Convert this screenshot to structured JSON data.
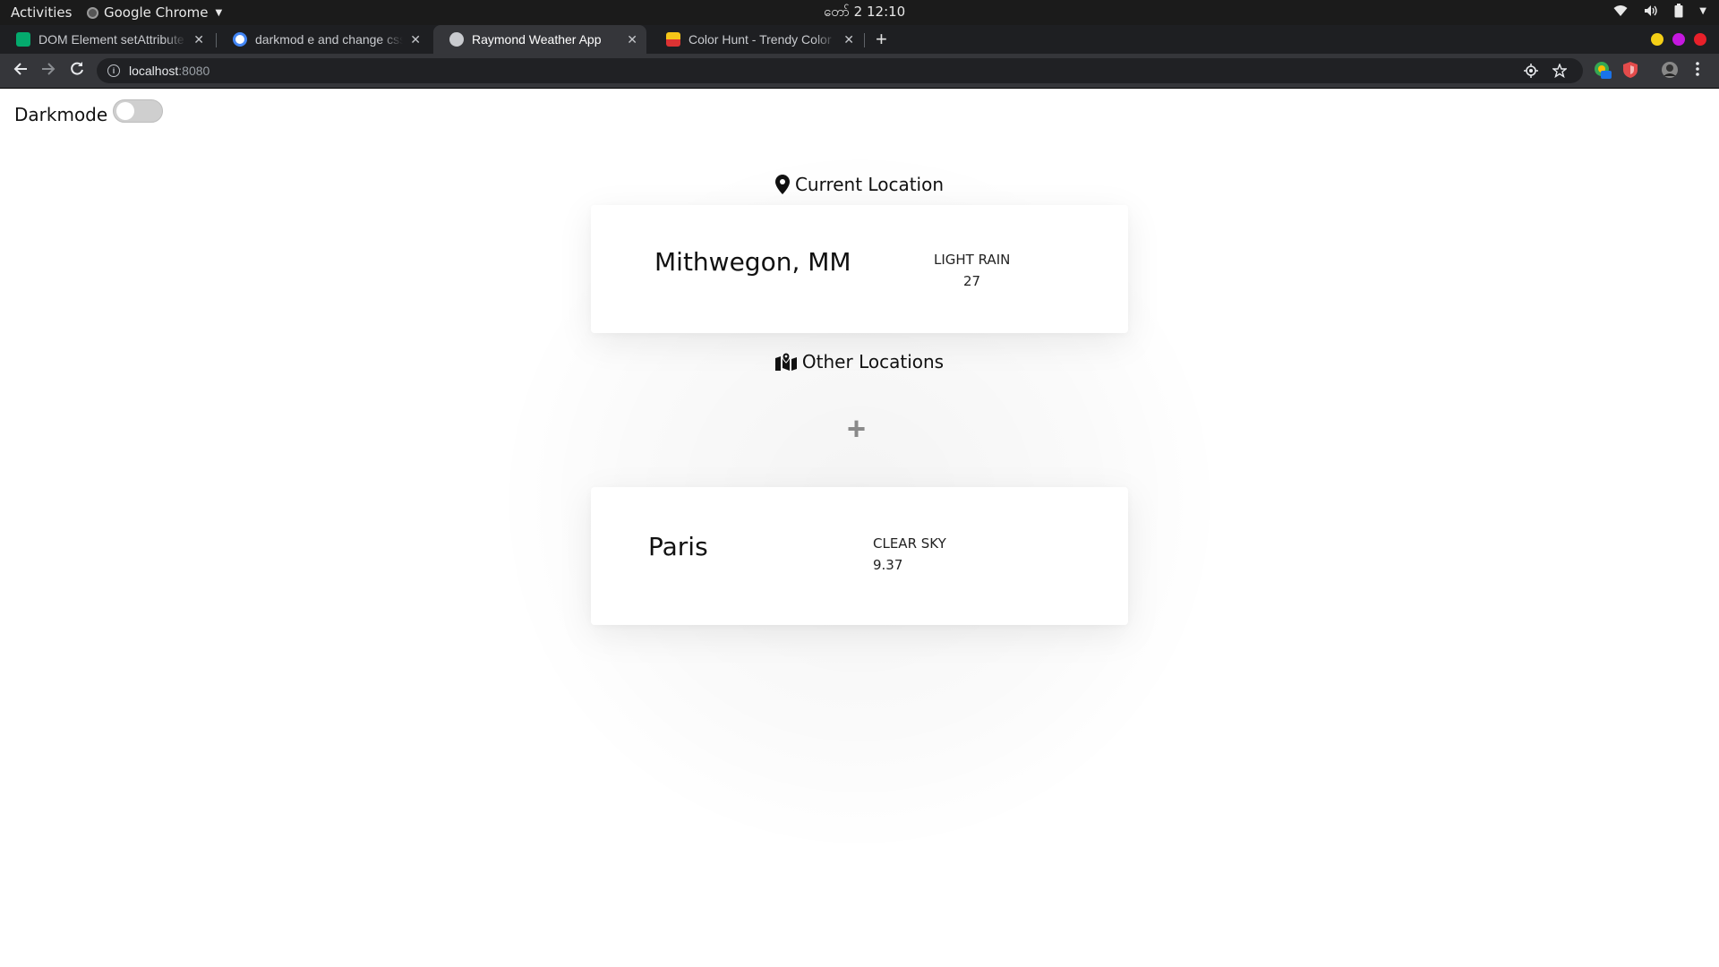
{
  "topbar": {
    "activities": "Activities",
    "app_name": "Google Chrome",
    "clock": "တော် 2  12:10"
  },
  "tabs": [
    {
      "title": "DOM Element setAttribute",
      "favicon": "w3schools-icon",
      "color": "#04aa6d"
    },
    {
      "title": "darkmod e and change css",
      "favicon": "google-icon",
      "color": "#4285f4"
    },
    {
      "title": "Raymond Weather App",
      "favicon": "globe-icon",
      "color": "#c9cbcf"
    },
    {
      "title": "Color Hunt - Trendy Color",
      "favicon": "colorhunt-icon",
      "color": "#f5c518"
    }
  ],
  "address_bar": {
    "host": "localhost",
    "port": ":8080"
  },
  "page": {
    "darkmode_label": "Darkmode",
    "darkmode_on": false,
    "current_location_title": "Current Location",
    "other_locations_title": "Other Locations",
    "add_symbol": "+",
    "current": {
      "city": "Mithwegon, MM",
      "description": "LIGHT RAIN",
      "temp": "27"
    },
    "others": [
      {
        "city": "Paris",
        "description": "CLEAR SKY",
        "temp": "9.37"
      }
    ]
  },
  "colors": {
    "window_close": "#e8202a",
    "window_max": "#c518e0",
    "window_min": "#f4cf16"
  }
}
